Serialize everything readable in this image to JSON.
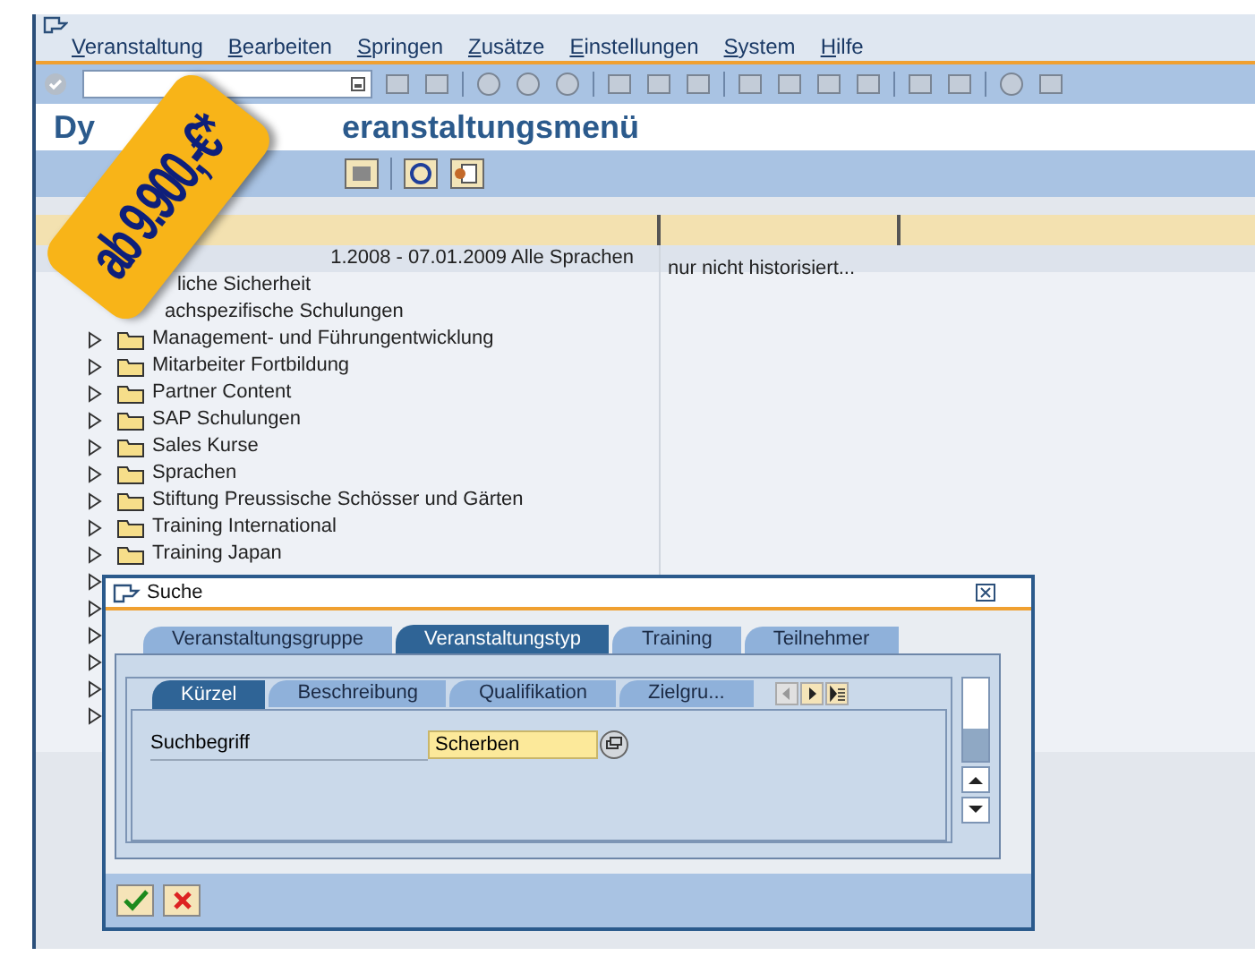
{
  "menu": [
    {
      "label": "Veranstaltung"
    },
    {
      "label": "Bearbeiten"
    },
    {
      "label": "Springen"
    },
    {
      "label": "Zusätze"
    },
    {
      "label": "Einstellungen"
    },
    {
      "label": "System"
    },
    {
      "label": "Hilfe"
    }
  ],
  "title_parts": [
    "Dy",
    "eranstaltungsmenü"
  ],
  "price_badge": {
    "text": "ab 9.900,-€*"
  },
  "header_row": {
    "cells": [
      "1.2008 - 07.01.2009 Alle Sprachen",
      "nur nicht historisiert..."
    ]
  },
  "tree": [
    {
      "label": "liche Sicherheit"
    },
    {
      "label": "achspezifische Schulungen"
    },
    {
      "label": "Management- und Führungentwicklung",
      "expanded": false
    },
    {
      "label": "Mitarbeiter Fortbildung",
      "expanded": false
    },
    {
      "label": "Partner Content",
      "expanded": false
    },
    {
      "label": "SAP Schulungen",
      "expanded": false
    },
    {
      "label": "Sales Kurse",
      "expanded": false
    },
    {
      "label": "Sprachen",
      "expanded": false
    },
    {
      "label": "Stiftung Preussische Schösser und Gärten",
      "expanded": false
    },
    {
      "label": "Training International",
      "expanded": false
    },
    {
      "label": "Training Japan",
      "expanded": false
    },
    {
      "expanded": false
    },
    {
      "expanded": false
    },
    {
      "expanded": false
    },
    {
      "expanded": false
    },
    {
      "expanded": false
    },
    {
      "expanded": false
    }
  ],
  "dialog": {
    "title": "Suche",
    "tabs": [
      {
        "label": "Veranstaltungsgruppe",
        "selected": false
      },
      {
        "label": "Veranstaltungstyp",
        "selected": true
      },
      {
        "label": "Training",
        "selected": false
      },
      {
        "label": "Teilnehmer",
        "selected": false
      }
    ],
    "subtabs": [
      {
        "label": "Kürzel",
        "selected": true
      },
      {
        "label": "Beschreibung",
        "selected": false
      },
      {
        "label": "Qualifikation",
        "selected": false
      },
      {
        "label": "Zielgru...",
        "selected": false
      }
    ],
    "field": {
      "label": "Suchbegriff",
      "value": "Scherben"
    }
  }
}
